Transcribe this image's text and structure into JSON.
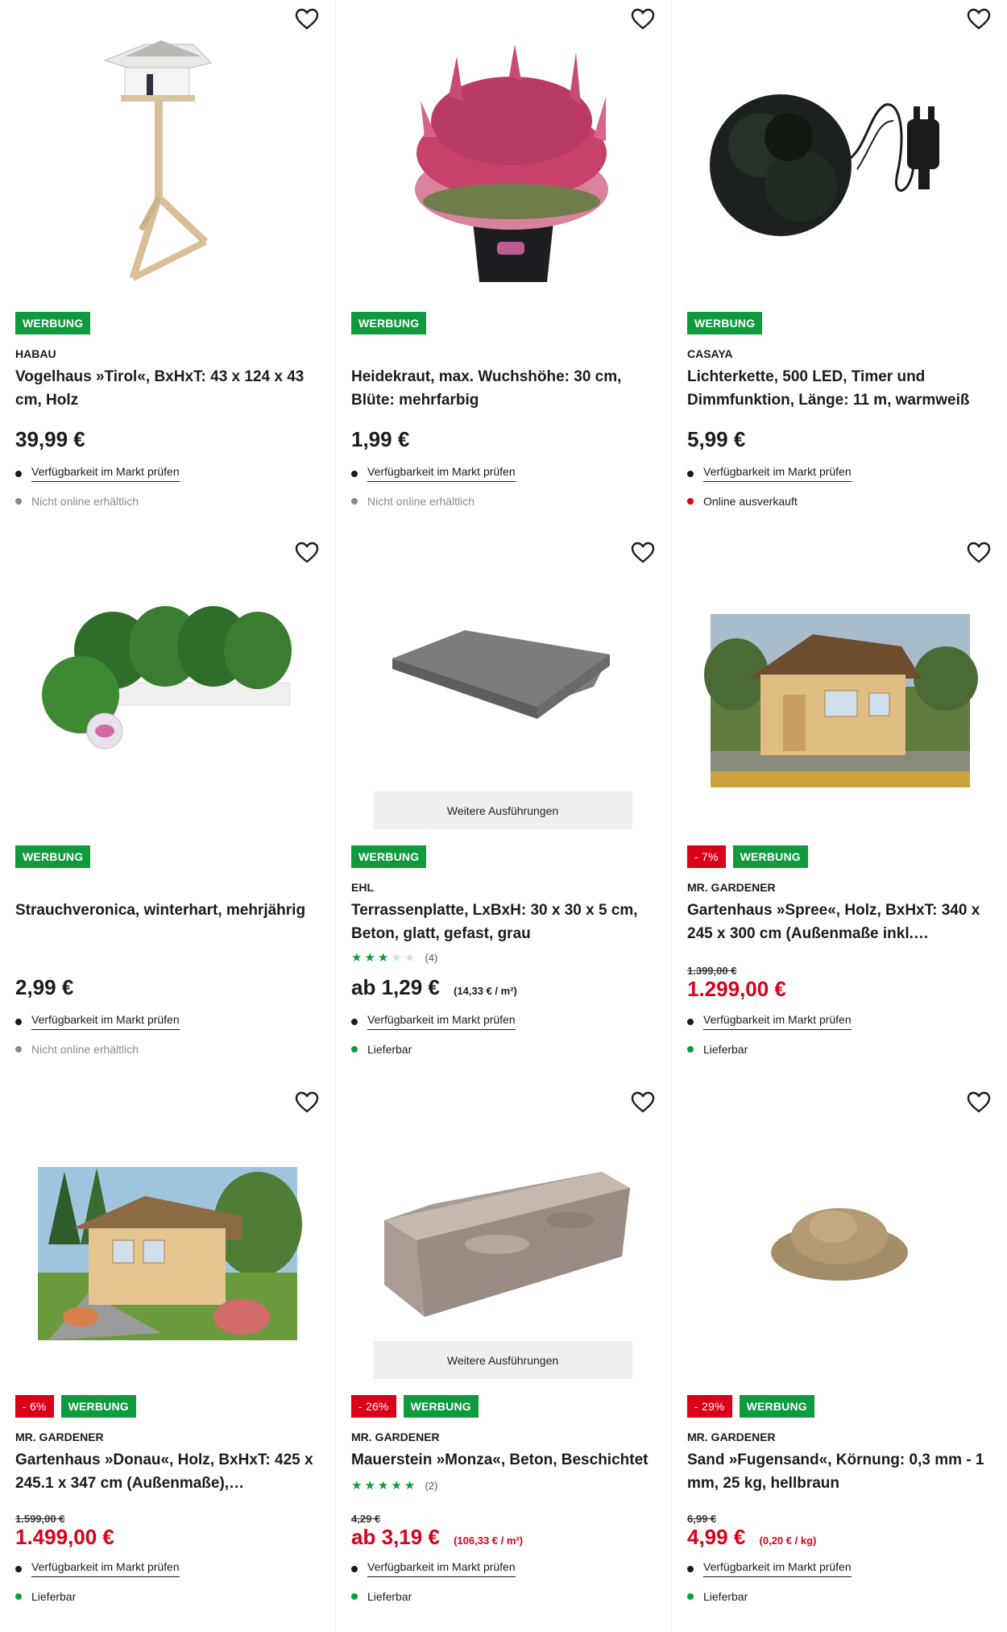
{
  "labels": {
    "ad_badge": "WERBUNG",
    "check_availability": "Verfügbarkeit im Markt prüfen",
    "more_variants": "Weitere Ausführungen"
  },
  "products": [
    {
      "brand": "HABAU",
      "title": "Vogelhaus »Tirol«, BxHxT: 43 x 124 x 43 cm, Holz",
      "price": "39,99 €",
      "status": "Nicht online erhältlich",
      "status_color": "#8a8a8a",
      "image": "bird-house-image"
    },
    {
      "brand": "",
      "title": "Heidekraut, max. Wuchshöhe: 30 cm, Blüte: mehrfarbig",
      "price": "1,99 €",
      "status": "Nicht online erhältlich",
      "status_color": "#8a8a8a",
      "image": "heather-plant-image"
    },
    {
      "brand": "CASAYA",
      "title": "Lichterkette, 500 LED, Timer und Dimmfunktion, Länge: 11 m, warmweiß",
      "price": "5,99 €",
      "status": "Online ausverkauft",
      "status_color": "#d9001a",
      "image": "light-chain-image"
    },
    {
      "brand": "",
      "title": "Strauchveronica, winterhart, mehrjährig",
      "price": "2,99 €",
      "status": "Nicht online erhältlich",
      "status_color": "#8a8a8a",
      "image": "shrub-veronica-image"
    },
    {
      "brand": "EHL",
      "title": "Terrassenplatte, LxBxH: 30 x 30 x 5 cm, Beton, glatt, gefast, grau",
      "rating_stars": 3,
      "rating_count": "(4)",
      "price": "ab 1,29 €",
      "unit_price": "(14,33 € / m²)",
      "status": "Lieferbar",
      "status_color": "#0e9a3d",
      "image": "terrace-slab-image"
    },
    {
      "discount": "- 7%",
      "brand": "MR. GARDENER",
      "title": "Gartenhaus »Spree«, Holz, BxHxT: 340 x 245 x 300 cm (Außenmaße inkl.…",
      "old_price": "1.399,00 €",
      "price": "1.299,00 €",
      "status": "Lieferbar",
      "status_color": "#0e9a3d",
      "image": "garden-house-spree-image"
    },
    {
      "discount": "- 6%",
      "brand": "MR. GARDENER",
      "title": "Gartenhaus »Donau«, Holz, BxHxT: 425 x 245.1 x 347 cm (Außenmaße),…",
      "old_price": "1.599,00 €",
      "price": "1.499,00 €",
      "status": "Lieferbar",
      "status_color": "#0e9a3d",
      "image": "garden-house-donau-image"
    },
    {
      "discount": "- 26%",
      "brand": "MR. GARDENER",
      "title": "Mauerstein »Monza«, Beton, Beschichtet",
      "rating_stars": 5,
      "rating_count": "(2)",
      "old_price": "4,29 €",
      "price": "ab 3,19 €",
      "unit_price": "(106,33 € / m²)",
      "status": "Lieferbar",
      "status_color": "#0e9a3d",
      "image": "wall-stone-image"
    },
    {
      "discount": "- 29%",
      "brand": "MR. GARDENER",
      "title": "Sand »Fugensand«, Körnung: 0,3 mm - 1 mm, 25 kg, hellbraun",
      "old_price": "6,99 €",
      "price": "4,99 €",
      "unit_price": "(0,20 € / kg)",
      "status": "Lieferbar",
      "status_color": "#0e9a3d",
      "image": "joint-sand-image"
    }
  ]
}
